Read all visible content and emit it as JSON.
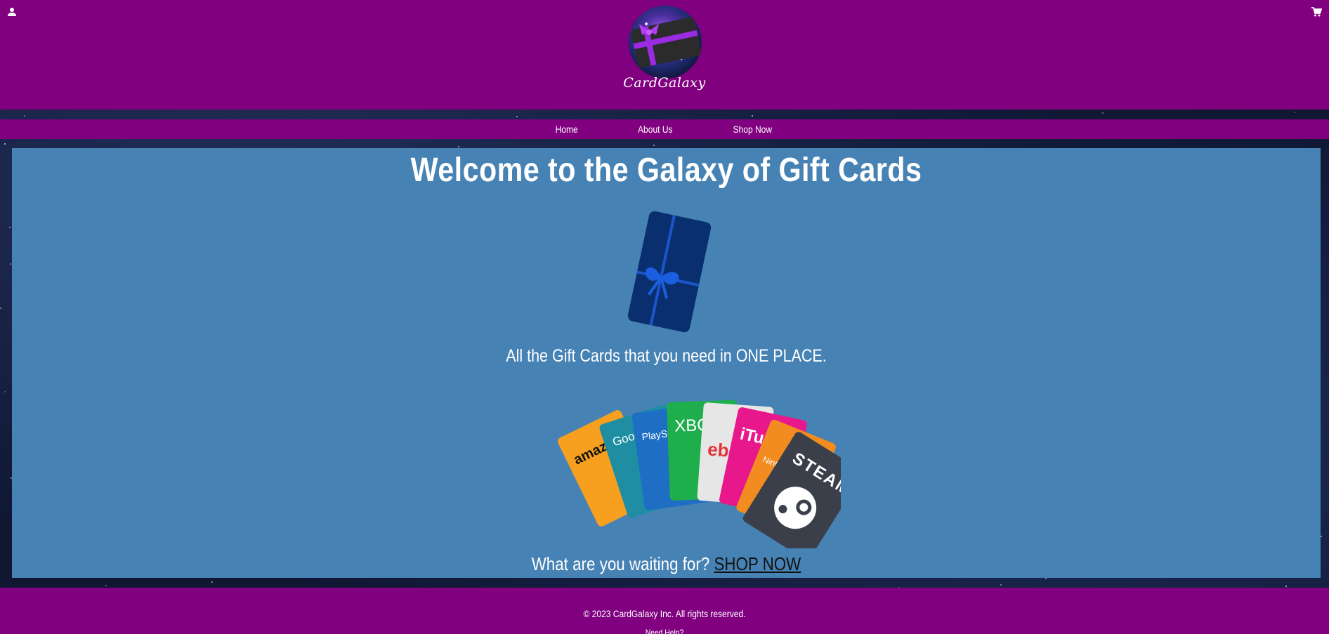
{
  "brand": {
    "name": "CardGalaxy"
  },
  "nav": {
    "items": [
      "Home",
      "About Us",
      "Shop Now"
    ]
  },
  "main": {
    "title": "Welcome to the Galaxy of Gift Cards",
    "tagline": "All the Gift Cards that you need in ONE PLACE.",
    "cta_text": "What are you waiting for?",
    "cta_link": "SHOP NOW",
    "gift_cards": [
      "amazon",
      "Google",
      "PlayStation",
      "XBOX",
      "ebay",
      "iTunes",
      "Nintendo",
      "STEAM"
    ]
  },
  "footer": {
    "copyright": "© 2023 CardGalaxy Inc. All rights reserved.",
    "link": "Need Help?"
  },
  "colors": {
    "header": "#800080",
    "panel": "#4682b4",
    "text": "#ffffff",
    "link": "#111111"
  },
  "icons": {
    "user": "user-icon",
    "cart": "shopping-cart-icon"
  }
}
